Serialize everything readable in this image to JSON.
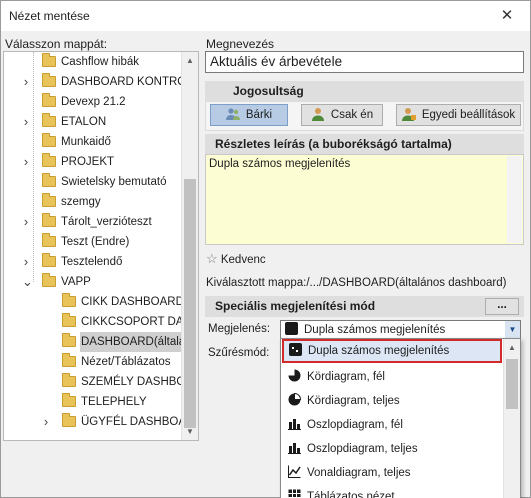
{
  "window": {
    "title": "Nézet mentése",
    "close_glyph": "✕"
  },
  "tree": {
    "label": "Válasszon mappát:",
    "rows": [
      {
        "label": "Cashflow hibák",
        "level": 1,
        "expandable": false,
        "selected": false
      },
      {
        "label": "DASHBOARD KONTRO...",
        "level": 1,
        "expandable": true,
        "selected": false
      },
      {
        "label": "Devexp 21.2",
        "level": 1,
        "expandable": false,
        "selected": false
      },
      {
        "label": "ETALON",
        "level": 1,
        "expandable": true,
        "selected": false
      },
      {
        "label": "Munkaidő",
        "level": 1,
        "expandable": false,
        "selected": false
      },
      {
        "label": "PROJEKT",
        "level": 1,
        "expandable": true,
        "selected": false
      },
      {
        "label": "Swietelsky bemutató",
        "level": 1,
        "expandable": false,
        "selected": false
      },
      {
        "label": "szemgy",
        "level": 1,
        "expandable": false,
        "selected": false
      },
      {
        "label": "Tárolt_verzióteszt",
        "level": 1,
        "expandable": true,
        "selected": false
      },
      {
        "label": "Teszt (Endre)",
        "level": 1,
        "expandable": false,
        "selected": false
      },
      {
        "label": "Tesztelendő",
        "level": 1,
        "expandable": true,
        "selected": false
      },
      {
        "label": "VAPP",
        "level": 1,
        "expandable": true,
        "expanded": true,
        "selected": false
      },
      {
        "label": "CIKK DASHBOARD",
        "level": 2,
        "expandable": false,
        "selected": false
      },
      {
        "label": "CIKKCSOPORT DA...",
        "level": 2,
        "expandable": false,
        "selected": false
      },
      {
        "label": "DASHBOARD(általá...",
        "level": 2,
        "expandable": false,
        "selected": true
      },
      {
        "label": "Nézet/Táblázatos",
        "level": 2,
        "expandable": false,
        "selected": false
      },
      {
        "label": "SZEMÉLY DASHBO...",
        "level": 2,
        "expandable": false,
        "selected": false
      },
      {
        "label": "TELEPHELY",
        "level": 2,
        "expandable": false,
        "selected": false
      },
      {
        "label": "ÜGYFÉL DASHBOARD",
        "level": 2,
        "expandable": true,
        "selected": false
      }
    ]
  },
  "name": {
    "label": "Megnevezés",
    "value": "Aktuális év árbevétele"
  },
  "permissions": {
    "header": "Jogosultság",
    "buttons": [
      {
        "label": "Bárki",
        "icon": "people-icon",
        "active": true
      },
      {
        "label": "Csak én",
        "icon": "user-icon",
        "active": false
      },
      {
        "label": "Egyedi beállítások",
        "icon": "user-settings-icon",
        "active": false
      }
    ]
  },
  "description": {
    "header": "Részletes leírás (a buborékságó tartalma)",
    "value": "Dupla számos megjelenítés"
  },
  "favorite": {
    "label": "Kedvenc",
    "icon": "star-icon"
  },
  "selected_folder": {
    "text": "Kiválasztott mappa:/.../DASHBOARD(általános dashboard)"
  },
  "special_display": {
    "header": "Speciális megjelenítési mód",
    "more_label": "...",
    "display_label": "Megjelenés:",
    "display_value": "Dupla számos megjelenítés",
    "filter_label": "Szűrésmód:"
  },
  "dropdown_options": [
    {
      "label": "Dupla számos megjelenítés",
      "icon": "double-number-icon",
      "highlighted": true
    },
    {
      "label": "Kördiagram, fél",
      "icon": "pie-half-icon",
      "highlighted": false
    },
    {
      "label": "Kördiagram, teljes",
      "icon": "pie-full-icon",
      "highlighted": false
    },
    {
      "label": "Oszlopdiagram, fél",
      "icon": "bar-chart-icon",
      "highlighted": false
    },
    {
      "label": "Oszlopdiagram, teljes",
      "icon": "bar-chart-icon",
      "highlighted": false
    },
    {
      "label": "Vonaldiagram, teljes",
      "icon": "line-chart-icon",
      "highlighted": false
    },
    {
      "label": "Táblázatos nézet",
      "icon": "table-icon",
      "highlighted": false
    }
  ],
  "colors": {
    "highlight_border": "#d12a2a",
    "active_button": "#b7cbe4",
    "description_bg": "#fdfdd3",
    "folder": "#e8c35a"
  }
}
